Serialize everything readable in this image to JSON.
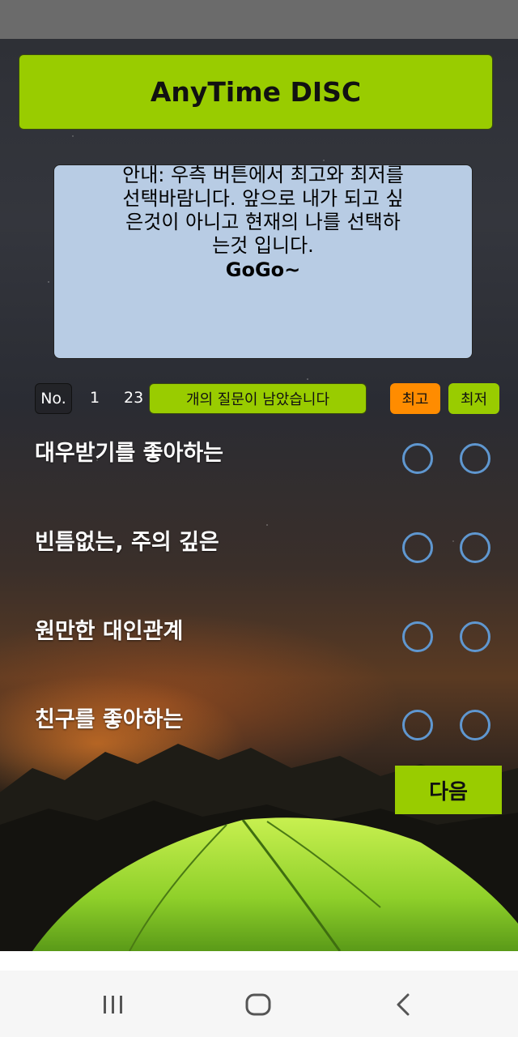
{
  "app": {
    "title": "AnyTime DISC",
    "accent_color": "#99cc00",
    "best_color": "#ff8c00",
    "radio_color": "#5f97d0"
  },
  "notice": {
    "line1": "안내: 우측 버튼에서 최고와 최저를",
    "line2": "선택바람니다.  앞으로 내가 되고 싶",
    "line3": "은것이 아니고 현재의 나를 선택하",
    "line4": "는것 입니다.",
    "line5": "GoGo~"
  },
  "progress": {
    "no_label": "No.",
    "current_number": "1",
    "remaining_count": "23",
    "remaining_label": "개의 질문이 남았습니다"
  },
  "columns": {
    "best_label": "최고",
    "worst_label": "최저"
  },
  "questions": [
    {
      "text": "대우받기를 좋아하는"
    },
    {
      "text": "빈틈없는, 주의 깊은"
    },
    {
      "text": "원만한 대인관계"
    },
    {
      "text": "친구를 좋아하는"
    }
  ],
  "actions": {
    "next_label": "다음"
  },
  "navbar": {
    "icons": [
      "recent-apps-icon",
      "home-icon",
      "back-icon"
    ]
  }
}
